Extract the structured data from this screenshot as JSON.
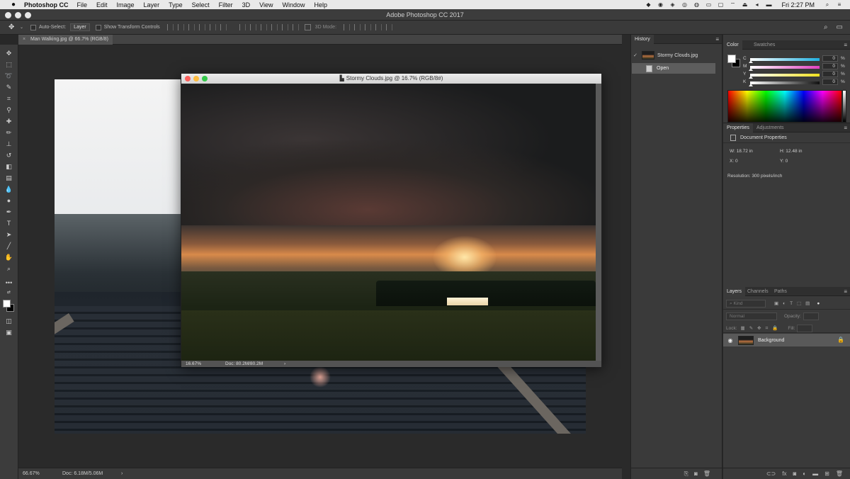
{
  "menubar": {
    "apple": "",
    "app_name": "Photoshop CC",
    "menus": [
      "File",
      "Edit",
      "Image",
      "Layer",
      "Type",
      "Select",
      "Filter",
      "3D",
      "View",
      "Window",
      "Help"
    ],
    "clock": "Fri 2:27 PM"
  },
  "window": {
    "title": "Adobe Photoshop CC 2017"
  },
  "options": {
    "auto_select_label": "Auto-Select:",
    "auto_select_target": "Layer",
    "transform_label": "Show Transform Controls",
    "mode_3d_label": "3D Mode:"
  },
  "doc_tab": {
    "close": "×",
    "label": "Man Walking.jpg @ 66.7% (RGB/8)"
  },
  "floating_doc": {
    "title": "Stormy Clouds.jpg @ 16.7% (RGB/8#)",
    "zoom": "16.67%",
    "doc_size": "Doc: 80.2M/80.2M",
    "arrow": "›"
  },
  "status": {
    "zoom": "66.67%",
    "doc_size": "Doc: 6.18M/5.06M",
    "arrow": "›"
  },
  "history": {
    "tab": "History",
    "snapshot": "Stormy Clouds.jpg",
    "states": [
      "Open"
    ]
  },
  "color": {
    "tabs": [
      "Color",
      "Swatches"
    ],
    "channels": [
      {
        "label": "C",
        "value": "0",
        "unit": "%",
        "bar": "#20b0e0"
      },
      {
        "label": "M",
        "value": "0",
        "unit": "%",
        "bar": "#e040c0"
      },
      {
        "label": "Y",
        "value": "0",
        "unit": "%",
        "bar": "#f0e020"
      },
      {
        "label": "K",
        "value": "0",
        "unit": "%",
        "bar": "#dddddd"
      }
    ],
    "foreground": "#ffffff",
    "background": "#000000"
  },
  "properties": {
    "tabs": [
      "Properties",
      "Adjustments"
    ],
    "heading": "Document Properties",
    "width": "W: 18.72 in",
    "height": "H: 12.48 in",
    "x": "X: 0",
    "y": "Y: 0",
    "resolution": "Resolution: 300 pixels/inch"
  },
  "layers": {
    "tabs": [
      "Layers",
      "Channels",
      "Paths"
    ],
    "kind_placeholder": "Kind",
    "blend_mode": "Normal",
    "opacity_label": "Opacity:",
    "lock_label": "Lock:",
    "fill_label": "Fill:",
    "layer_name": "Background"
  }
}
